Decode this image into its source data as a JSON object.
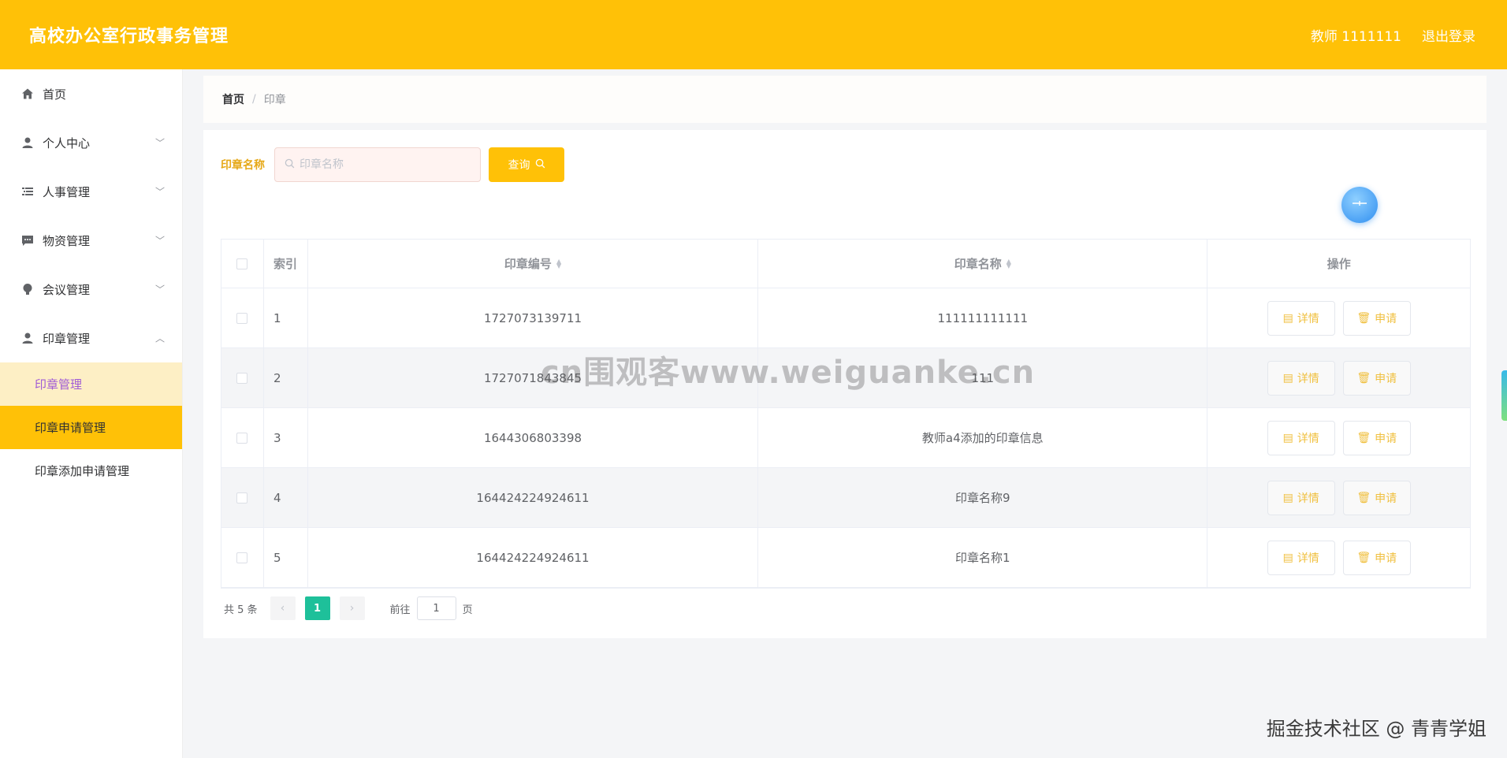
{
  "header": {
    "app_title": "高校办公室行政事务管理",
    "user_label": "教师 1111111",
    "logout_label": "退出登录"
  },
  "sidebar": {
    "items": [
      {
        "label": "首页",
        "icon": "home-icon",
        "expandable": false
      },
      {
        "label": "个人中心",
        "icon": "user-icon",
        "expandable": true,
        "expanded": false
      },
      {
        "label": "人事管理",
        "icon": "list-icon",
        "expandable": true,
        "expanded": false
      },
      {
        "label": "物资管理",
        "icon": "message-icon",
        "expandable": true,
        "expanded": false
      },
      {
        "label": "会议管理",
        "icon": "bulb-icon",
        "expandable": true,
        "expanded": false
      },
      {
        "label": "印章管理",
        "icon": "user-icon",
        "expandable": true,
        "expanded": true
      }
    ],
    "sub_items": [
      {
        "label": "印章管理",
        "state": "hover"
      },
      {
        "label": "印章申请管理",
        "state": "active"
      },
      {
        "label": "印章添加申请管理",
        "state": "normal"
      }
    ]
  },
  "breadcrumb": {
    "home": "首页",
    "separator": "/",
    "current": "印章"
  },
  "search": {
    "label": "印章名称",
    "placeholder": "印章名称",
    "value": "",
    "button_label": "查询"
  },
  "table": {
    "columns": [
      "索引",
      "印章编号",
      "印章名称",
      "操作"
    ],
    "rows": [
      {
        "index": "1",
        "number": "1727073139711",
        "name": "111111111111"
      },
      {
        "index": "2",
        "number": "1727071843845",
        "name": "111"
      },
      {
        "index": "3",
        "number": "1644306803398",
        "name": "教师a4添加的印章信息"
      },
      {
        "index": "4",
        "number": "164424224924611",
        "name": "印章名称9"
      },
      {
        "index": "5",
        "number": "164424224924611",
        "name": "印章名称1"
      }
    ],
    "actions": {
      "detail": "详情",
      "apply": "申请"
    }
  },
  "pagination": {
    "total_text": "共 5 条",
    "current_page": "1",
    "goto_prefix": "前往",
    "goto_value": "1",
    "goto_suffix": "页"
  },
  "watermarks": {
    "center": "cn围观客www.weiguanke.cn",
    "bottom_right": "掘金技术社区 @ 青青学姐"
  },
  "colors": {
    "primary": "#ffc107",
    "pager_active": "#1ec09a",
    "submenu_hover_bg": "#fdefc5",
    "submenu_hover_text": "#a05bd6",
    "action_text": "#f0c040"
  }
}
